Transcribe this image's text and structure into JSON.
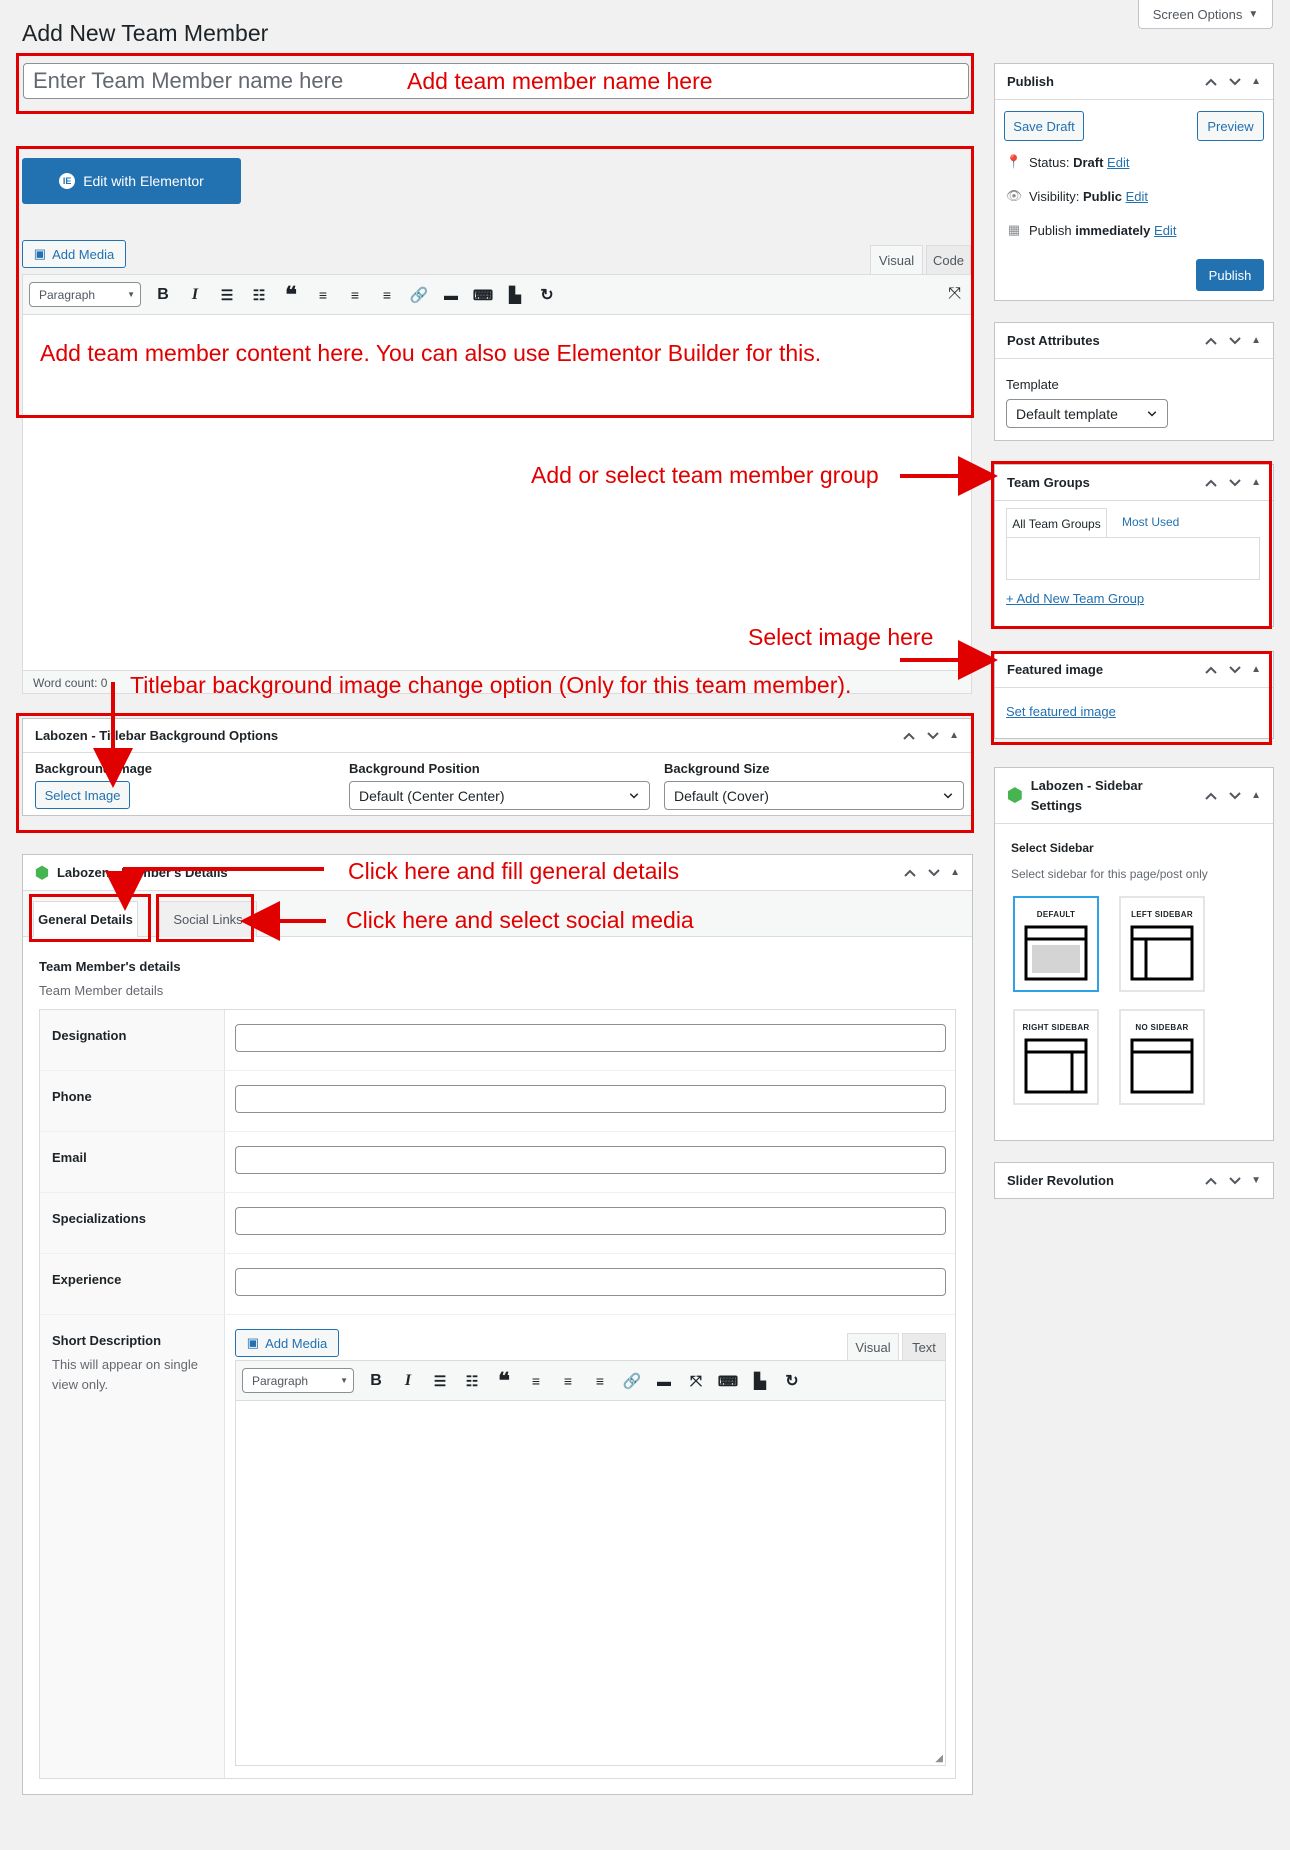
{
  "page": {
    "title": "Add New Team Member",
    "screen_options": "Screen Options"
  },
  "title_field": {
    "placeholder": "Enter Team Member name here"
  },
  "editor": {
    "elementor_button": "Edit with Elementor",
    "add_media": "Add Media",
    "tab_visual": "Visual",
    "tab_code": "Code",
    "format_select": "Paragraph",
    "word_count": "Word count: 0"
  },
  "titlebar_box": {
    "title": "Labozen - Titlebar Background Options",
    "bg_image_label": "Background Image",
    "select_image": "Select Image",
    "bg_position_label": "Background Position",
    "bg_position_value": "Default (Center Center)",
    "bg_size_label": "Background Size",
    "bg_size_value": "Default (Cover)"
  },
  "members_box": {
    "title": "Labozen - Member's Details",
    "tab_general": "General Details",
    "tab_social": "Social Links",
    "section_title": "Team Member's details",
    "section_desc": "Team Member details",
    "fields": [
      {
        "label": "Designation"
      },
      {
        "label": "Phone"
      },
      {
        "label": "Email"
      },
      {
        "label": "Specializations"
      },
      {
        "label": "Experience"
      }
    ],
    "short_desc_label": "Short Description",
    "short_desc_hint": "This will appear on single view only.",
    "sd_add_media": "Add Media",
    "sd_tab_visual": "Visual",
    "sd_tab_text": "Text",
    "sd_format": "Paragraph"
  },
  "publish_box": {
    "title": "Publish",
    "save_draft": "Save Draft",
    "preview": "Preview",
    "status_label": "Status: ",
    "status_value": "Draft",
    "visibility_label": "Visibility: ",
    "visibility_value": "Public",
    "publish_label": "Publish ",
    "publish_value": "immediately",
    "edit": "Edit",
    "publish_button": "Publish"
  },
  "attributes_box": {
    "title": "Post Attributes",
    "template_label": "Template",
    "template_value": "Default template"
  },
  "groups_box": {
    "title": "Team Groups",
    "tab_all": "All Team Groups",
    "tab_used": "Most Used",
    "add_new": "+ Add New Team Group"
  },
  "featured_box": {
    "title": "Featured image",
    "set_link": "Set featured image"
  },
  "sidebar_box": {
    "title_line1": "Labozen - Sidebar",
    "title_line2": "Settings",
    "select_label": "Select Sidebar",
    "select_desc": "Select sidebar for this page/post only",
    "layouts": [
      "DEFAULT",
      "LEFT SIDEBAR",
      "RIGHT SIDEBAR",
      "NO SIDEBAR"
    ]
  },
  "slider_box": {
    "title": "Slider Revolution"
  },
  "annotations": {
    "name": "Add team member name here",
    "content": "Add team member content here. You can also use Elementor Builder for this.",
    "group": "Add or select team member group",
    "image": "Select image here",
    "titlebar": "Titlebar background image change option (Only for this team member).",
    "general": "Click here and fill general details",
    "social": "Click here and select social media"
  },
  "colors": {
    "accent": "#2271b1",
    "annotation": "#e00000",
    "selected_layout": "#2ea2e6"
  }
}
